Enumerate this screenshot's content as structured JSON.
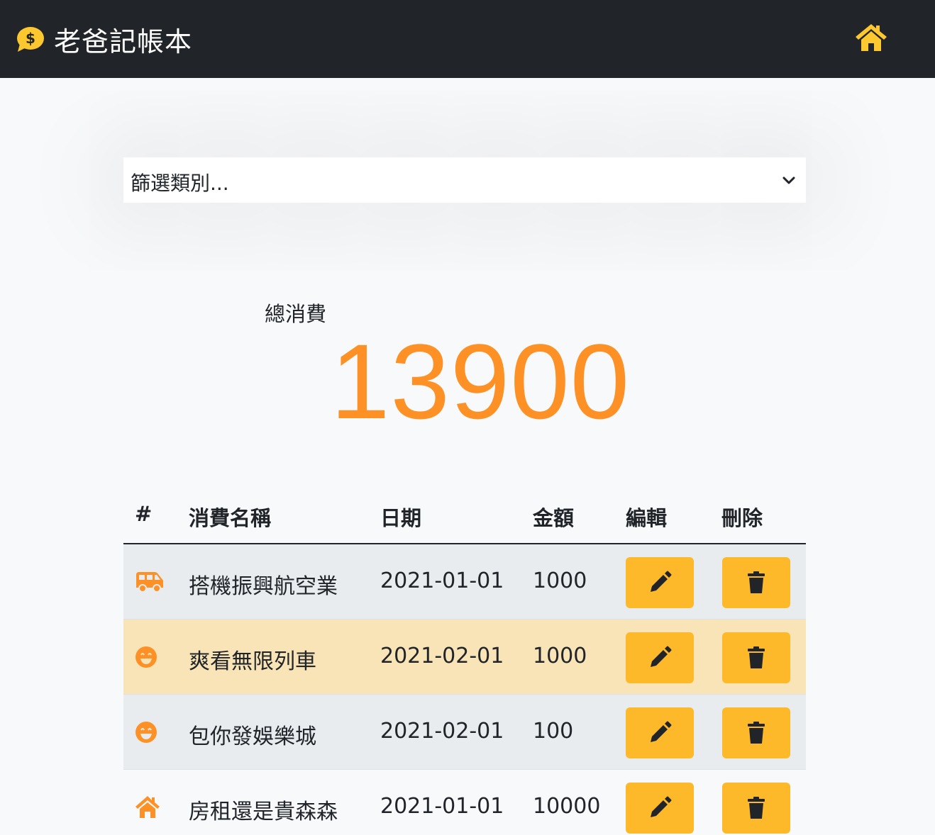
{
  "app": {
    "title": "老爸記帳本",
    "logo_icon": "dollar-speech-bubble-icon",
    "home_icon": "home-icon",
    "accent": "#fdb92a"
  },
  "filter": {
    "selected": "篩選類別..."
  },
  "summary": {
    "label": "總消費",
    "total": "13900",
    "color": "#fd9126"
  },
  "table": {
    "headers": {
      "index": "#",
      "name": "消費名稱",
      "date": "日期",
      "amount": "金額",
      "edit": "編輯",
      "delete": "刪除"
    },
    "rows": [
      {
        "icon": "shuttle-van-icon",
        "name": "搭機振興航空業",
        "date": "2021-01-01",
        "amount": "1000"
      },
      {
        "icon": "grin-beam-icon",
        "name": "爽看無限列車",
        "date": "2021-02-01",
        "amount": "1000"
      },
      {
        "icon": "grin-beam-icon",
        "name": "包你發娛樂城",
        "date": "2021-02-01",
        "amount": "100"
      },
      {
        "icon": "home-icon",
        "name": "房租還是貴森森",
        "date": "2021-01-01",
        "amount": "10000"
      }
    ]
  }
}
